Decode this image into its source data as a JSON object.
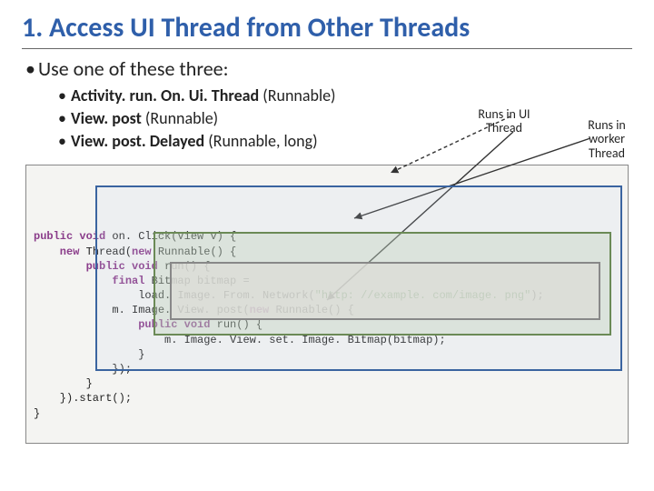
{
  "title": "1. Access UI Thread from Other Threads",
  "main_bullet": "Use one of these three:",
  "sub_bullets": [
    {
      "bold": "Activity. run. On. Ui. Thread",
      "rest": " (Runnable)"
    },
    {
      "bold": "View. post",
      "rest": " (Runnable)"
    },
    {
      "bold": "View. post. Delayed",
      "rest": " (Runnable, long)"
    }
  ],
  "labels": {
    "ui": "Runs in UI Thread",
    "worker": "Runs in worker Thread"
  },
  "code": {
    "l1a": "public void",
    "l1b": " on. Click(View v) {",
    "l2a": "    new",
    "l2b": " Thread(",
    "l2c": "new",
    "l2d": " Runnable() {",
    "l3a": "        public void",
    "l3b": " run() {",
    "l4a": "            final",
    "l4b": " Bitmap bitmap =",
    "l5a": "                load. Image. From. Network(",
    "l5b": "\"http: //example. com/image. png\"",
    "l5c": ");",
    "l6a": "            m. Image. View. post(",
    "l6b": "new",
    "l6c": " Runnable() {",
    "l7a": "                public void",
    "l7b": " run() {",
    "l8": "                    m. Image. View. set. Image. Bitmap(bitmap);",
    "l9": "                }",
    "l10": "            });",
    "l11": "        }",
    "l12": "    }).start();",
    "l13": "}"
  }
}
